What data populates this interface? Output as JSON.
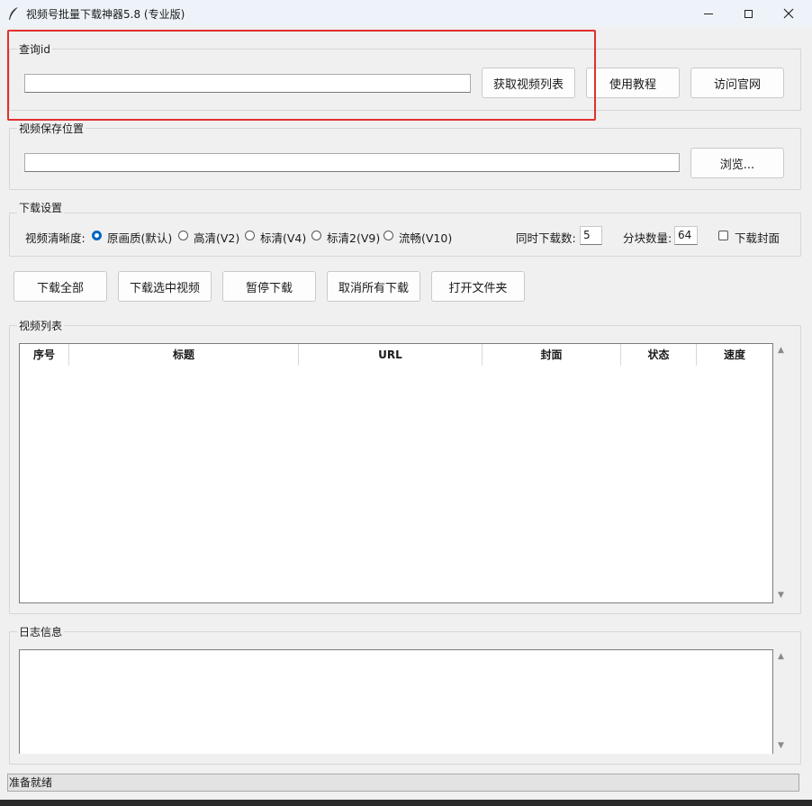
{
  "window": {
    "title": "视频号批量下载神器5.8 (专业版)",
    "minimize_glyph": "—",
    "maximize_glyph": "☐",
    "close_glyph": "✕"
  },
  "query": {
    "group_label": "查询id",
    "input_value": "",
    "fetch_label": "获取视频列表",
    "tutorial_label": "使用教程",
    "website_label": "访问官网"
  },
  "save": {
    "group_label": "视频保存位置",
    "path_value": "",
    "browse_label": "浏览..."
  },
  "settings": {
    "group_label": "下载设置",
    "quality_label": "视频清晰度:",
    "quality_options": [
      "原画质(默认)",
      "高清(V2)",
      "标清(V4)",
      "标清2(V9)",
      "流畅(V10)"
    ],
    "quality_selected_index": 0,
    "concurrent_label": "同时下载数:",
    "concurrent_value": "5",
    "chunk_label": "分块数量:",
    "chunk_value": "64",
    "cover_label": "下载封面",
    "cover_checked": false
  },
  "actions": {
    "download_all": "下载全部",
    "download_selected": "下载选中视频",
    "pause": "暂停下载",
    "cancel_all": "取消所有下载",
    "open_folder": "打开文件夹"
  },
  "video_list": {
    "group_label": "视频列表",
    "columns": [
      "序号",
      "标题",
      "URL",
      "封面",
      "状态",
      "速度"
    ],
    "rows": []
  },
  "log": {
    "group_label": "日志信息",
    "content": ""
  },
  "status_bar": {
    "text": "准备就绪"
  },
  "colors": {
    "highlight": "#e0302f",
    "accent": "#0067c0",
    "background": "#f0f0f0"
  }
}
